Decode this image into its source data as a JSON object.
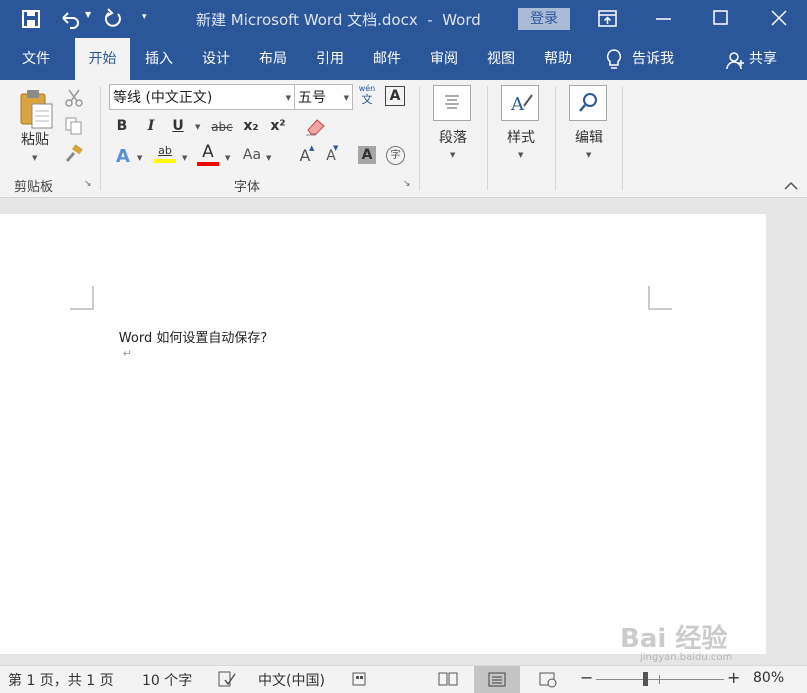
{
  "title": {
    "doc_title": "新建 Microsoft Word 文档.docx  -  Word",
    "login": "登录"
  },
  "tabs": [
    "文件",
    "开始",
    "插入",
    "设计",
    "布局",
    "引用",
    "邮件",
    "审阅",
    "视图",
    "帮助"
  ],
  "tell_me": "告诉我",
  "share": "共享",
  "ribbon": {
    "paste": "粘贴",
    "clipboard_group": "剪贴板",
    "font_name": "等线 (中文正文)",
    "font_size": "五号",
    "font_group": "字体",
    "bold": "B",
    "italic": "I",
    "underline": "U",
    "strike": "abc",
    "subscript": "x₂",
    "superscript": "x²",
    "phonetic_top": "wén",
    "phonetic_bottom": "文",
    "border_char": "A",
    "font_color": "A",
    "highlight": "ab",
    "text_effects": "A",
    "change_case": "Aa",
    "grow_font": "A",
    "shrink_font": "A",
    "char_shading": "A",
    "enclose_char": "字",
    "paragraph": "段落",
    "styles": "样式",
    "editing": "编辑"
  },
  "document": {
    "text": "Word 如何设置自动保存?",
    "para_mark": "↵"
  },
  "status": {
    "page": "第 1 页，共 1 页",
    "words": "10 个字",
    "language": "中文(中国)",
    "zoom": "80%",
    "zoom_minus": "−",
    "zoom_plus": "+"
  },
  "watermark": {
    "text": "Bai 经验",
    "url": "jingyan.baidu.com"
  },
  "colors": {
    "accent": "#2b579a",
    "ribbon": "#f3f3f3",
    "highlight_bar": "#ffff00",
    "font_color_bar": "#ff0000"
  }
}
